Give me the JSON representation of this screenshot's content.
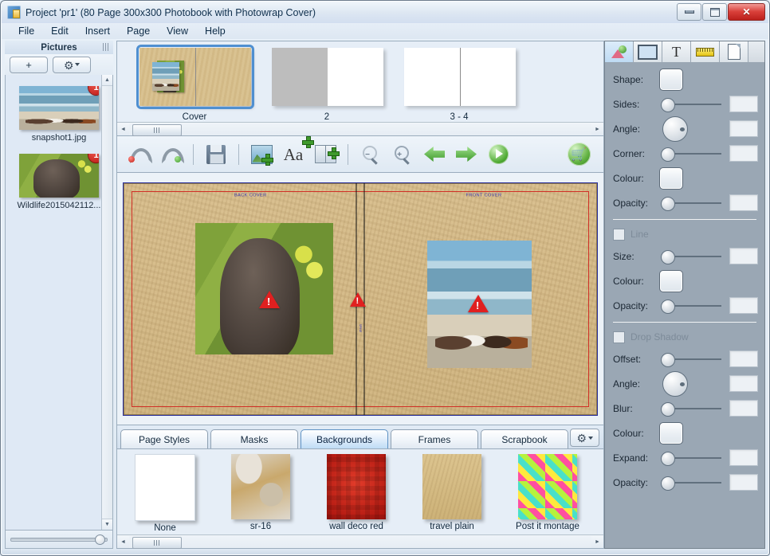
{
  "window": {
    "title": "Project 'pr1' (80 Page 300x300 Photobook with Photowrap Cover)",
    "minimize_label": "–",
    "maximize_label": "□",
    "close_label": "✕"
  },
  "menu": {
    "items": [
      {
        "label": "File"
      },
      {
        "label": "Edit"
      },
      {
        "label": "Insert"
      },
      {
        "label": "Page"
      },
      {
        "label": "View"
      },
      {
        "label": "Help"
      }
    ]
  },
  "pictures_panel": {
    "title": "Pictures",
    "add_label": "+",
    "options_label": "",
    "scroll_up": "▲",
    "scroll_down": "▼",
    "items": [
      {
        "label": "snapshot1.jpg",
        "badge": "1",
        "thumb": "horses-beach-photo"
      },
      {
        "label": "Wildlife2015042112...",
        "badge": "1",
        "thumb": "marmot-photo"
      }
    ]
  },
  "page_strip": {
    "spreads": [
      {
        "caption": "Cover",
        "selected": true,
        "type": "cover"
      },
      {
        "caption": "2",
        "selected": false,
        "type": "half-grey"
      },
      {
        "caption": "3 - 4",
        "selected": false,
        "type": "blank"
      }
    ],
    "scroll_left": "◄",
    "scroll_right": "►"
  },
  "toolbar": {
    "buttons": [
      {
        "name": "undo",
        "icon": "undo-icon"
      },
      {
        "name": "redo",
        "icon": "redo-icon"
      },
      {
        "name": "save",
        "icon": "save-icon"
      },
      {
        "name": "add-picture",
        "icon": "add-picture-icon"
      },
      {
        "name": "add-text",
        "icon": "add-text-icon"
      },
      {
        "name": "add-page",
        "icon": "add-page-icon"
      },
      {
        "name": "zoom-out",
        "icon": "zoom-out-icon"
      },
      {
        "name": "zoom-in",
        "icon": "zoom-in-icon"
      },
      {
        "name": "previous-page",
        "icon": "arrow-left-icon"
      },
      {
        "name": "next-page",
        "icon": "arrow-right-icon"
      },
      {
        "name": "preview",
        "icon": "play-icon"
      },
      {
        "name": "order",
        "icon": "shopping-cart-icon"
      }
    ]
  },
  "canvas": {
    "back_cover_label": "BACK COVER",
    "front_cover_label": "FRONT COVER",
    "spine_label": "SPINE",
    "warning_symbol": "!",
    "photos": [
      {
        "name": "marmot-photo",
        "warning": true
      },
      {
        "name": "horses-photo",
        "warning": true
      }
    ]
  },
  "content_tabs": {
    "tabs": [
      {
        "label": "Page Styles",
        "active": false
      },
      {
        "label": "Masks",
        "active": false
      },
      {
        "label": "Backgrounds",
        "active": true
      },
      {
        "label": "Frames",
        "active": false
      },
      {
        "label": "Scrapbook",
        "active": false
      }
    ],
    "options_label": ""
  },
  "gallery": {
    "items": [
      {
        "label": "None",
        "swatch": "none"
      },
      {
        "label": "sr-16",
        "swatch": "sr16"
      },
      {
        "label": "wall  deco  red",
        "swatch": "wall-deco-red"
      },
      {
        "label": "travel plain",
        "swatch": "travel-plain"
      },
      {
        "label": "Post it montage",
        "swatch": "post-it-montage"
      }
    ],
    "scroll_left": "◄",
    "scroll_right": "►"
  },
  "properties_panel": {
    "tabs": [
      {
        "name": "shapes",
        "icon": "shapes-icon",
        "active": true
      },
      {
        "name": "frame",
        "icon": "frame-icon",
        "active": false
      },
      {
        "name": "text",
        "icon": "text-icon",
        "active": false
      },
      {
        "name": "ruler",
        "icon": "ruler-icon",
        "active": false
      },
      {
        "name": "page",
        "icon": "page-icon",
        "active": false
      }
    ],
    "shape_section": [
      {
        "label": "Shape:",
        "control": "swatch",
        "value": ""
      },
      {
        "label": "Sides:",
        "control": "slider",
        "value": ""
      },
      {
        "label": "Angle:",
        "control": "dial",
        "value": ""
      },
      {
        "label": "Corner:",
        "control": "slider",
        "value": ""
      },
      {
        "label": "Colour:",
        "control": "swatch",
        "value": ""
      },
      {
        "label": "Opacity:",
        "control": "slider",
        "value": ""
      }
    ],
    "line_section": {
      "checkbox_label": "Line",
      "checked": false,
      "rows": [
        {
          "label": "Size:",
          "control": "slider",
          "value": ""
        },
        {
          "label": "Colour:",
          "control": "swatch",
          "value": ""
        },
        {
          "label": "Opacity:",
          "control": "slider",
          "value": ""
        }
      ]
    },
    "shadow_section": {
      "checkbox_label": "Drop Shadow",
      "checked": false,
      "rows": [
        {
          "label": "Offset:",
          "control": "slider",
          "value": ""
        },
        {
          "label": "Angle:",
          "control": "dial",
          "value": ""
        },
        {
          "label": "Blur:",
          "control": "slider",
          "value": ""
        },
        {
          "label": "Colour:",
          "control": "swatch",
          "value": ""
        },
        {
          "label": "Expand:",
          "control": "slider",
          "value": ""
        },
        {
          "label": "Opacity:",
          "control": "slider",
          "value": ""
        }
      ]
    }
  },
  "colors": {
    "accent": "#4f8fd0",
    "panel": "#9aa7b4",
    "warning": "#e02020",
    "badge": "#bc1410",
    "cover_paper": "#d2b783"
  }
}
